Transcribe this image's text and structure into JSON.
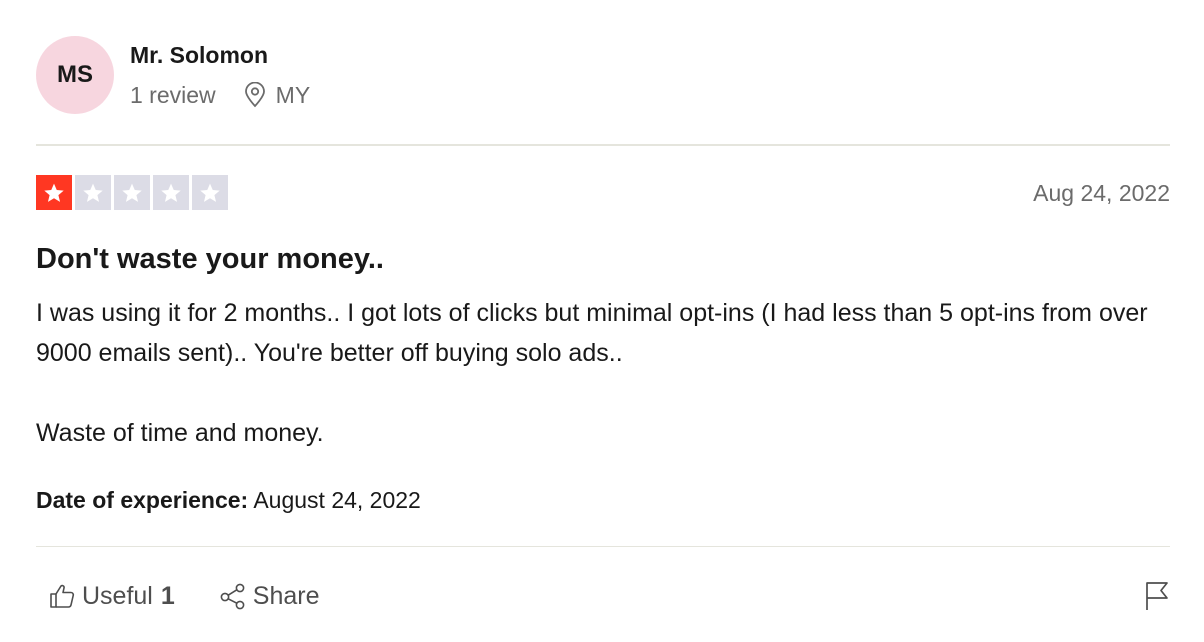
{
  "reviewer": {
    "initials": "MS",
    "name": "Mr. Solomon",
    "review_count": "1 review",
    "country": "MY",
    "avatar_color": "#f7d6df"
  },
  "rating": {
    "stars": 1,
    "max_stars": 5,
    "filled_color": "#ff3722",
    "empty_color": "#dcdce6"
  },
  "review": {
    "date": "Aug 24, 2022",
    "title": "Don't waste your money..",
    "paragraphs": [
      "I was using it for 2 months.. I got lots of clicks but minimal opt-ins (I had less than 5 opt-ins from over 9000 emails sent).. You're better off buying solo ads..",
      "Waste of time and money."
    ],
    "experience_label": "Date of experience:",
    "experience_date": "August 24, 2022"
  },
  "actions": {
    "useful_label": "Useful",
    "useful_count": "1",
    "share_label": "Share",
    "icons": [
      "thumbs-up-icon",
      "share-icon",
      "flag-icon"
    ]
  }
}
